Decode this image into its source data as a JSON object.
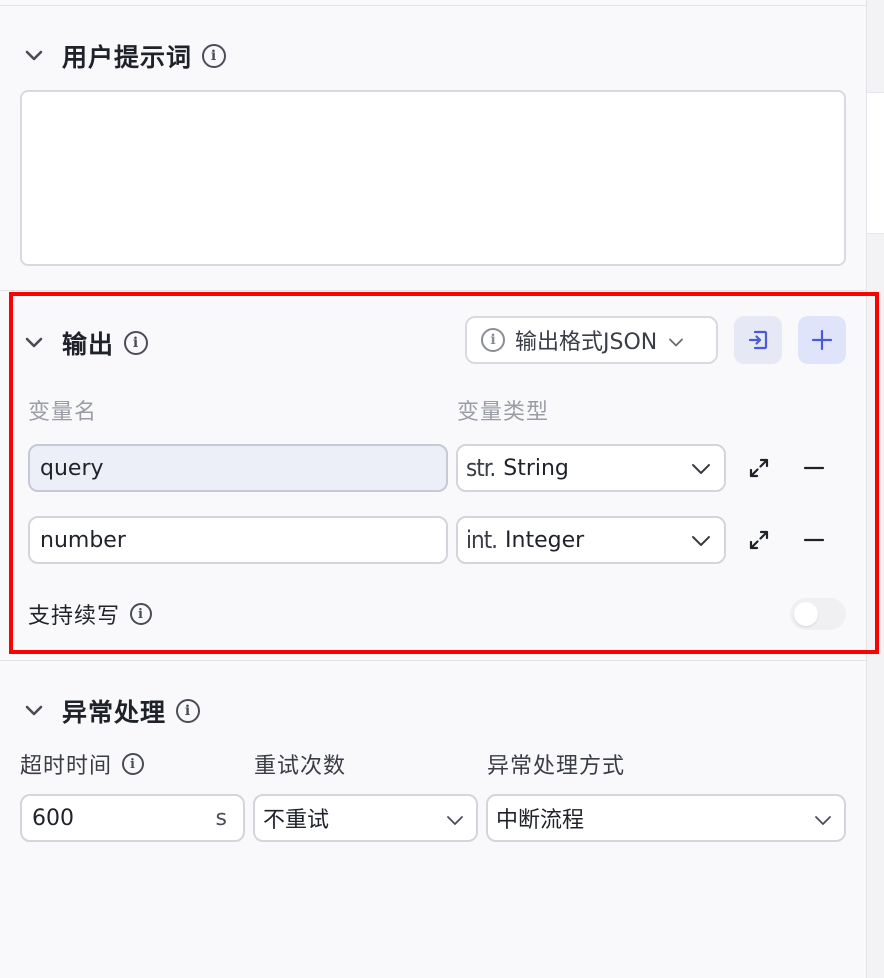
{
  "user_prompt": {
    "title": "用户提示词",
    "value": ""
  },
  "output": {
    "title": "输出",
    "format_button": "输出格式JSON",
    "col_name": "变量名",
    "col_type": "变量类型",
    "variables": [
      {
        "name": "query",
        "type_prefix": "str.",
        "type": "String"
      },
      {
        "name": "number",
        "type_prefix": "int.",
        "type": "Integer"
      }
    ],
    "continue_label": "支持续写",
    "continue_enabled": false
  },
  "exception": {
    "title": "异常处理",
    "timeout_label": "超时时间",
    "timeout_value": "600",
    "timeout_unit": "s",
    "retry_label": "重试次数",
    "retry_value": "不重试",
    "method_label": "异常处理方式",
    "method_value": "中断流程"
  },
  "colors": {
    "highlight": "#ff0000",
    "accent": "#4b5bd6",
    "add_button_bg": "#e0e4fb"
  }
}
